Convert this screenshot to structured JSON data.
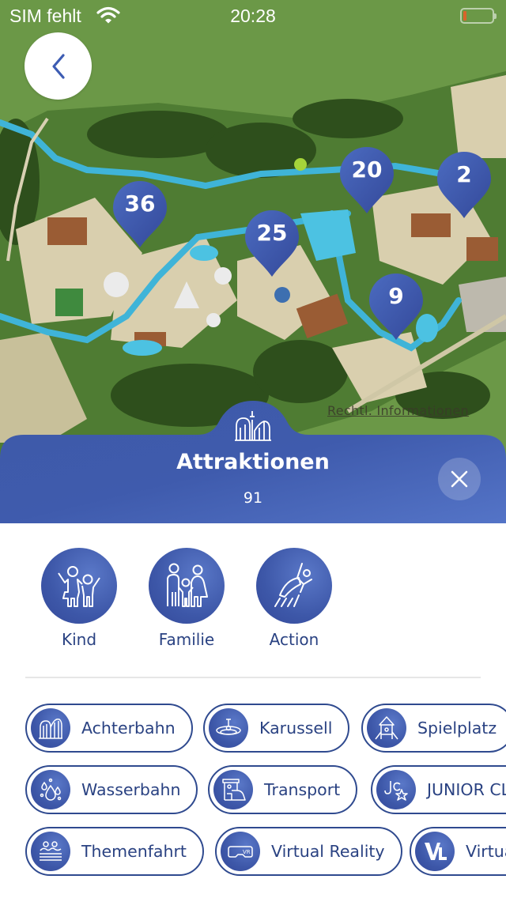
{
  "status_bar": {
    "carrier": "SIM fehlt",
    "time": "20:28",
    "battery_level_percent": 5
  },
  "map": {
    "back_icon": "chevron-left-icon",
    "legal_link": "Rechtl. Informationen",
    "pins": [
      {
        "label": "36",
        "area": "west"
      },
      {
        "label": "25",
        "area": "center"
      },
      {
        "label": "20",
        "area": "north-center"
      },
      {
        "label": "2",
        "area": "north-east"
      },
      {
        "label": "9",
        "area": "east"
      }
    ],
    "colors": {
      "pin": "#3f5cb0",
      "grass": "#6b9847",
      "water": "#3fb4d8"
    }
  },
  "sheet": {
    "category_icon": "roller-coaster-icon",
    "title": "Attraktionen",
    "count": "91",
    "close_icon": "close-icon",
    "accent": "#4563b5"
  },
  "audience_filters": [
    {
      "label": "Kind",
      "icon": "kids-icon"
    },
    {
      "label": "Familie",
      "icon": "family-icon"
    },
    {
      "label": "Action",
      "icon": "action-icon"
    }
  ],
  "type_chips": [
    {
      "label": "Achterbahn",
      "icon": "roller-coaster-icon"
    },
    {
      "label": "Karussell",
      "icon": "carousel-icon"
    },
    {
      "label": "Spielplatz",
      "icon": "playground-icon"
    },
    {
      "label": "Wasserbahn",
      "icon": "water-drops-icon"
    },
    {
      "label": "Transport",
      "icon": "transport-icon"
    },
    {
      "label": "JUNIOR CLUB",
      "icon": "junior-club-icon"
    },
    {
      "label": "Themenfahrt",
      "icon": "themed-ride-icon"
    },
    {
      "label": "Virtual Reality",
      "icon": "vr-headset-icon"
    },
    {
      "label": "Virtual Line",
      "icon": "virtual-line-icon"
    }
  ]
}
